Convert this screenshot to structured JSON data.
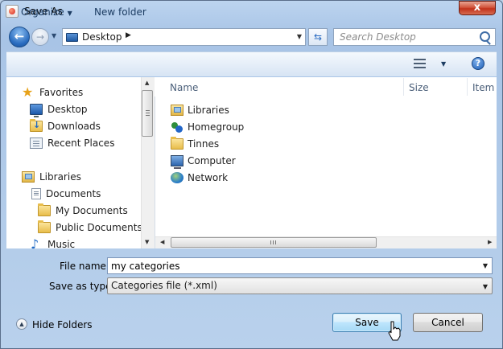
{
  "window": {
    "title": "Save As",
    "close_glyph": "x"
  },
  "nav": {
    "address_location": "Desktop",
    "search_placeholder": "Search Desktop"
  },
  "toolbar": {
    "organize_label": "Organize",
    "new_folder_label": "New folder"
  },
  "sidebar": {
    "items": [
      {
        "label": "Favorites",
        "icon": "star-icon"
      },
      {
        "label": "Desktop",
        "icon": "desktop-icon"
      },
      {
        "label": "Downloads",
        "icon": "downloads-folder-icon"
      },
      {
        "label": "Recent Places",
        "icon": "recent-places-icon"
      },
      {
        "label": "Libraries",
        "icon": "libraries-icon"
      },
      {
        "label": "Documents",
        "icon": "documents-icon"
      },
      {
        "label": "My Documents",
        "icon": "folder-icon"
      },
      {
        "label": "Public Documents",
        "icon": "folder-icon"
      },
      {
        "label": "Music",
        "icon": "music-icon"
      }
    ]
  },
  "file_list": {
    "columns": [
      "Name",
      "Size",
      "Item t"
    ],
    "rows": [
      {
        "name": "Libraries",
        "icon": "libraries-icon"
      },
      {
        "name": "Homegroup",
        "icon": "homegroup-icon"
      },
      {
        "name": "Tinnes",
        "icon": "folder-icon"
      },
      {
        "name": "Computer",
        "icon": "computer-icon"
      },
      {
        "name": "Network",
        "icon": "network-icon"
      }
    ]
  },
  "form": {
    "file_name_label": "File name:",
    "file_name_value": "my categories",
    "save_type_label": "Save as type:",
    "save_type_value": "Categories file (*.xml)"
  },
  "footer": {
    "hide_folders_label": "Hide Folders",
    "save_label": "Save",
    "cancel_label": "Cancel"
  },
  "colors": {
    "title_bar": "#bcd4ef",
    "close_button": "#c1321b",
    "save_button": "#a7d9f5"
  }
}
